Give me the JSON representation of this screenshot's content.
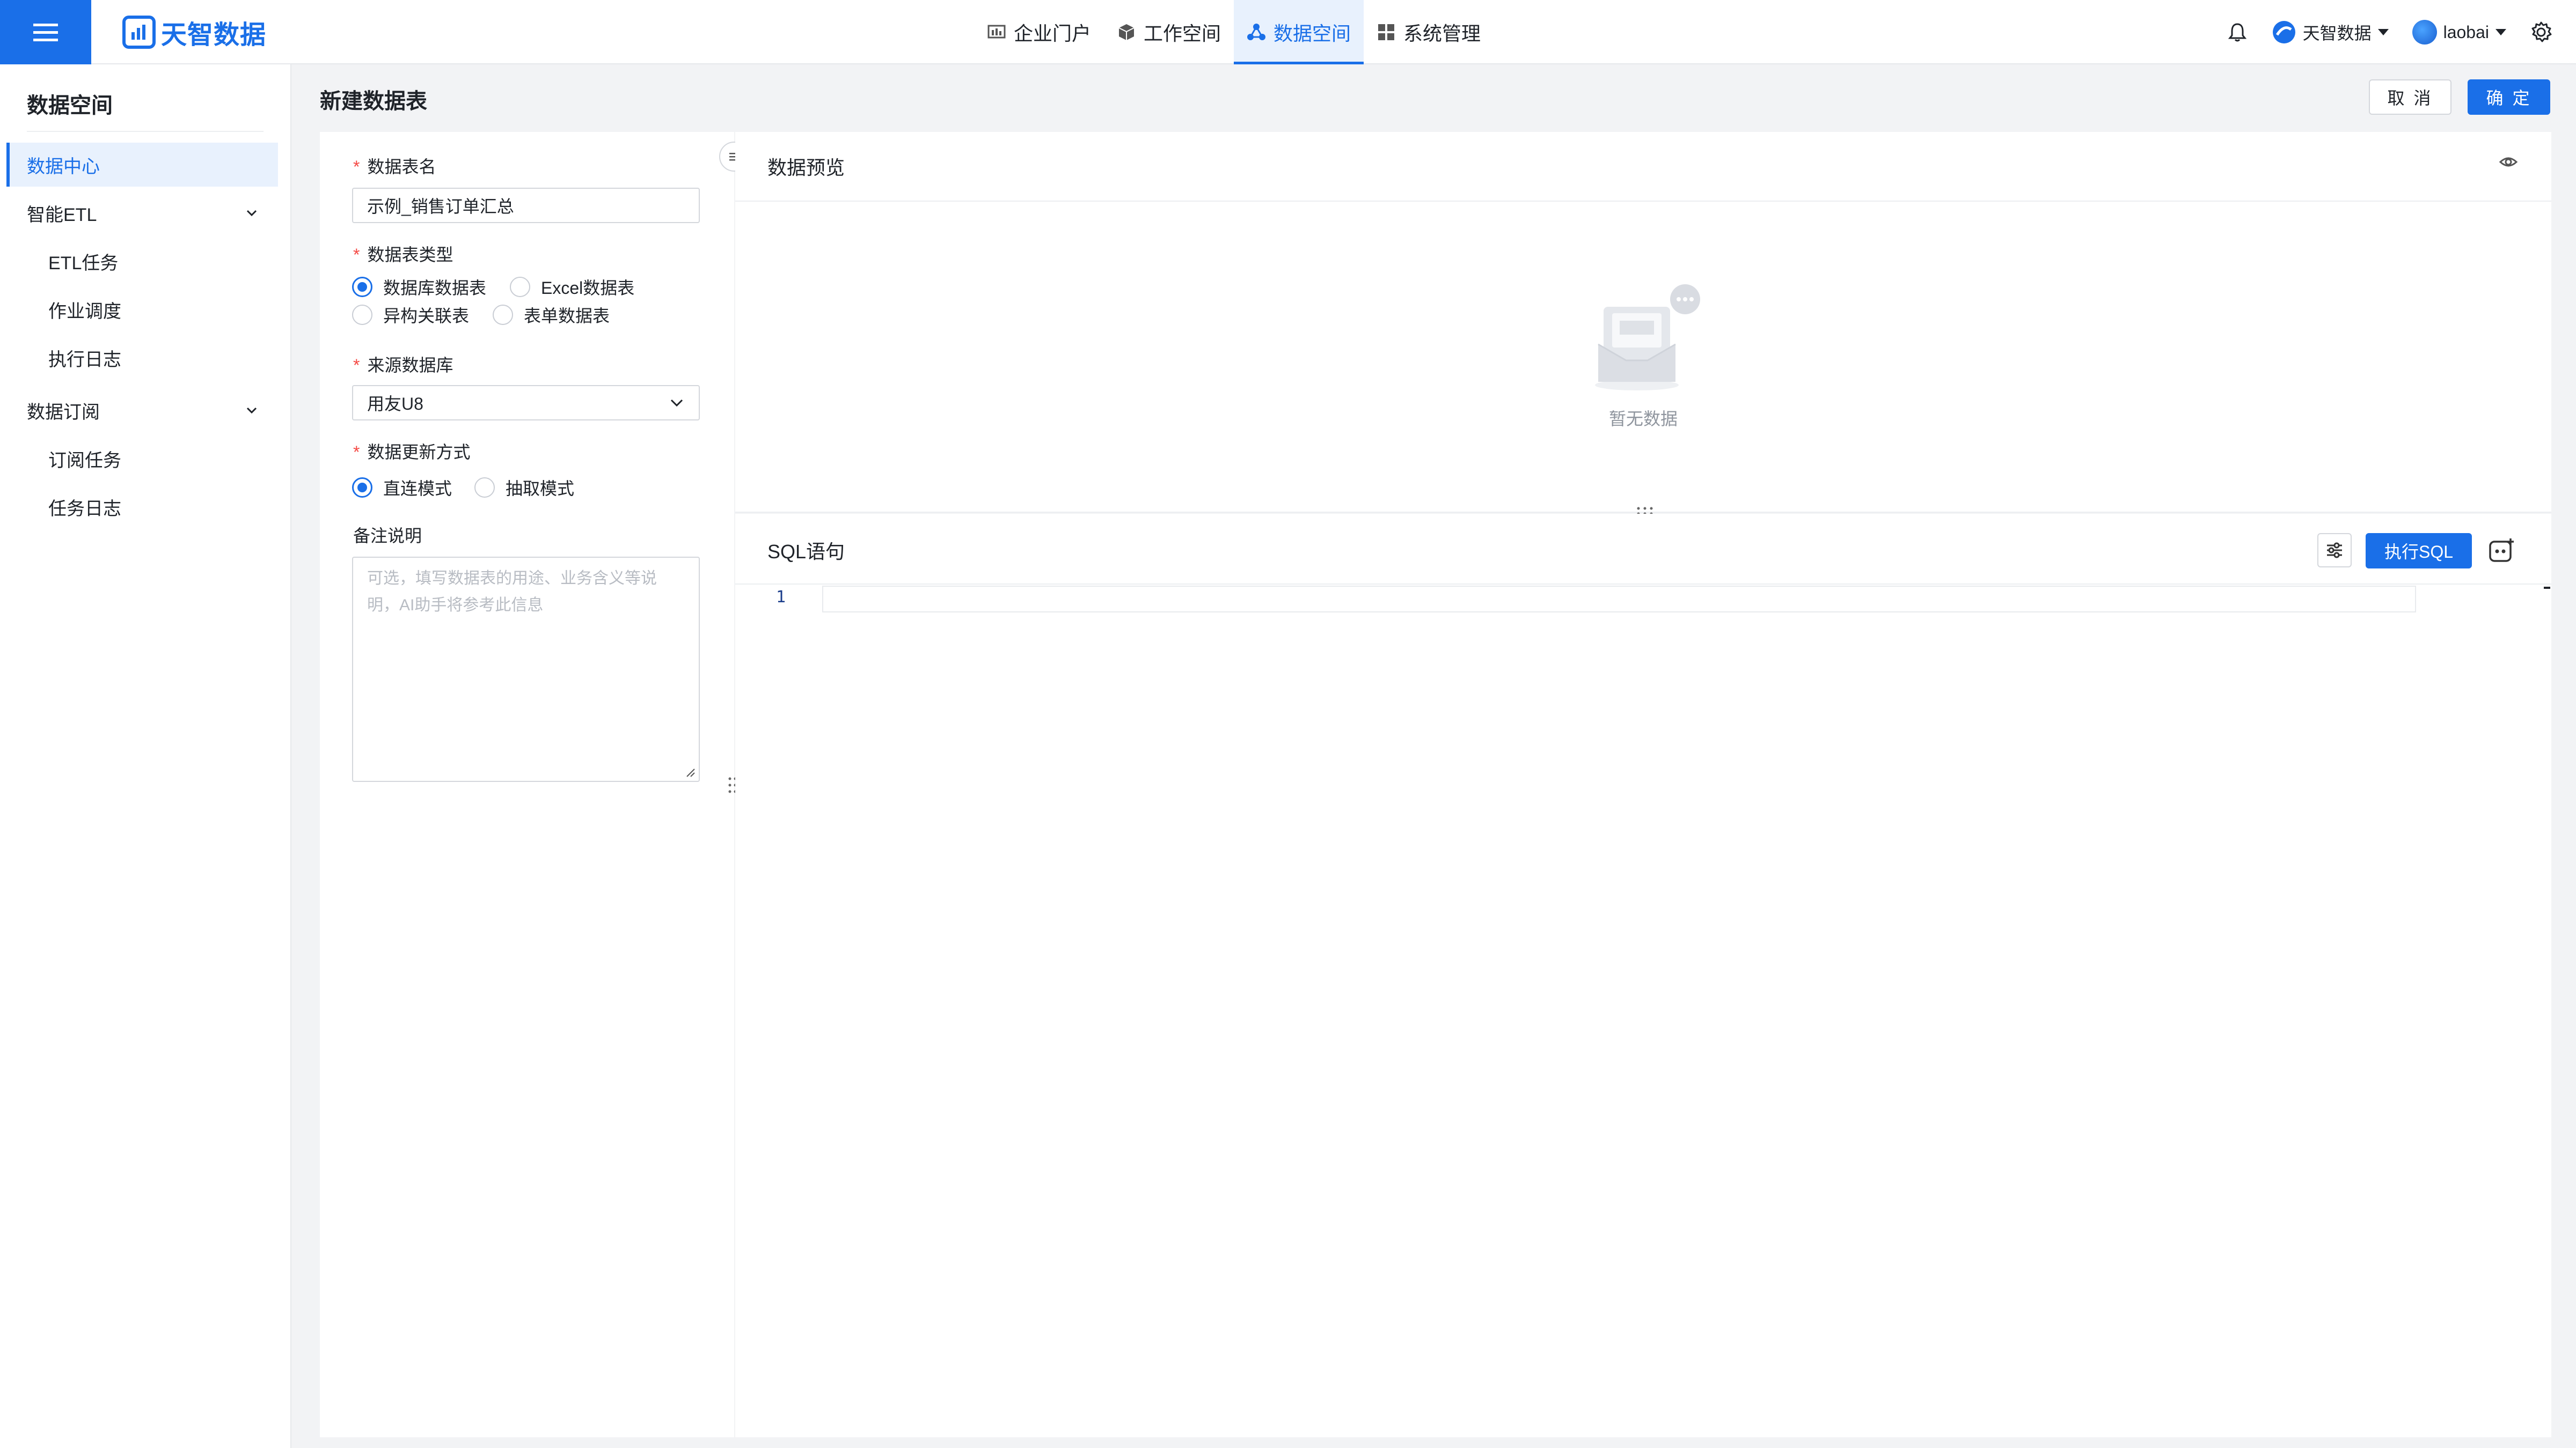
{
  "header": {
    "logo_text": "天智数据",
    "nav": [
      {
        "label": "企业门户",
        "icon": "dashboard-icon",
        "active": false
      },
      {
        "label": "工作空间",
        "icon": "cube-icon",
        "active": false
      },
      {
        "label": "数据空间",
        "icon": "share-nodes-icon",
        "active": true
      },
      {
        "label": "系统管理",
        "icon": "grid-icon",
        "active": false
      }
    ],
    "org_label": "天智数据",
    "user_label": "laobai"
  },
  "sidebar": {
    "title": "数据空间",
    "items": [
      {
        "label": "数据中心",
        "active": true
      },
      {
        "label": "智能ETL",
        "expandable": true
      },
      {
        "label": "ETL任务"
      },
      {
        "label": "作业调度"
      },
      {
        "label": "执行日志"
      },
      {
        "label": "数据订阅",
        "expandable": true
      },
      {
        "label": "订阅任务"
      },
      {
        "label": "任务日志"
      }
    ]
  },
  "page": {
    "title": "新建数据表",
    "cancel_label": "取 消",
    "ok_label": "确 定"
  },
  "form": {
    "name_label": "数据表名",
    "name_value": "示例_销售订单汇总",
    "type_label": "数据表类型",
    "type_options": [
      "数据库数据表",
      "Excel数据表",
      "异构关联表",
      "表单数据表"
    ],
    "type_selected": "数据库数据表",
    "source_label": "来源数据库",
    "source_value": "用友U8",
    "update_label": "数据更新方式",
    "update_options": [
      "直连模式",
      "抽取模式"
    ],
    "update_selected": "直连模式",
    "remark_label": "备注说明",
    "remark_placeholder": "可选，填写数据表的用途、业务含义等说明，AI助手将参考此信息"
  },
  "preview": {
    "title": "数据预览",
    "empty_text": "暂无数据"
  },
  "sql": {
    "title": "SQL语句",
    "run_label": "执行SQL",
    "line_number": "1",
    "code": ""
  }
}
